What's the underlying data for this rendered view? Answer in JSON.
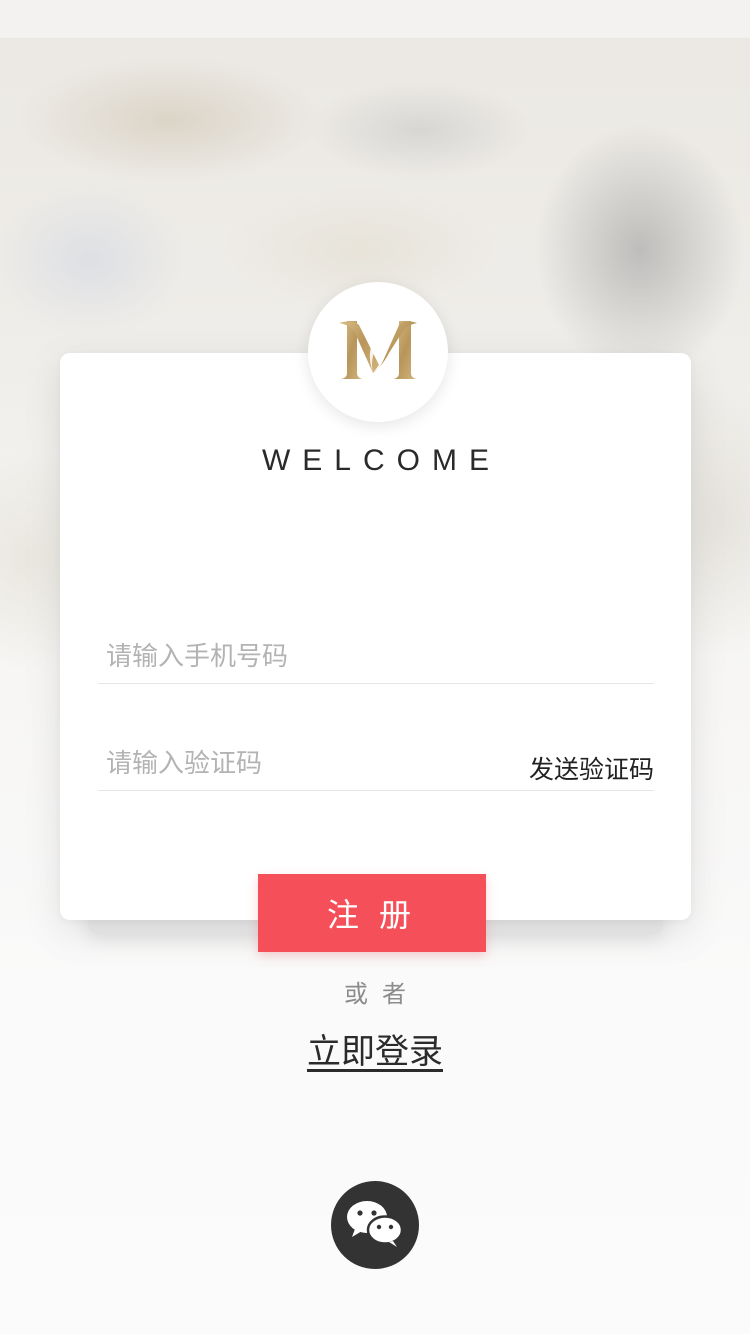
{
  "header": {
    "welcome_text": "WELCOME"
  },
  "form": {
    "phone_placeholder": "请输入手机号码",
    "phone_value": "",
    "code_placeholder": "请输入验证码",
    "code_value": "",
    "send_code_label": "发送验证码"
  },
  "actions": {
    "register_label": "注册",
    "or_text": "或者",
    "login_label": "立即登录"
  },
  "icons": {
    "logo": "brand-m-logo-icon",
    "social": "wechat-icon"
  },
  "colors": {
    "accent": "#f5505a",
    "logo_gold": "#c2a268",
    "wechat_bg": "#333333"
  }
}
